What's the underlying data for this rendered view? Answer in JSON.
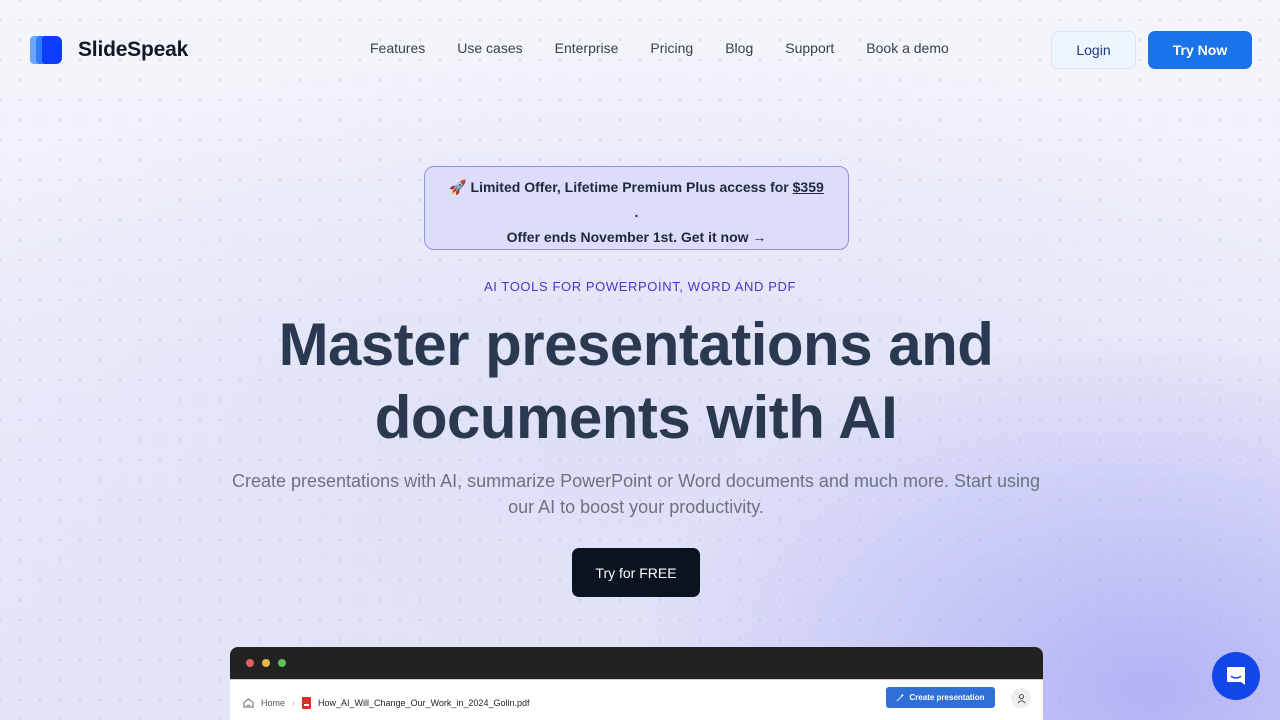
{
  "brand": {
    "name": "SlideSpeak",
    "logo_icon": "slides-stack-icon",
    "colors": {
      "primary": "#1a73e8",
      "logo_dark": "#0b3dff",
      "logo_mid": "#2f7bff",
      "logo_light": "#6aa8ff"
    }
  },
  "nav": {
    "items": [
      {
        "label": "Features"
      },
      {
        "label": "Use cases"
      },
      {
        "label": "Enterprise"
      },
      {
        "label": "Pricing"
      },
      {
        "label": "Blog"
      },
      {
        "label": "Support"
      },
      {
        "label": "Book a demo"
      }
    ],
    "login_label": "Login",
    "try_now_label": "Try Now"
  },
  "promo": {
    "icon": "🚀",
    "line1": "Limited Offer, Lifetime Premium Plus access for ",
    "price": "$359",
    "line2": ".",
    "line3": "Offer ends November 1st. Get it now →"
  },
  "hero": {
    "eyebrow": "AI TOOLS FOR POWERPOINT, WORD AND PDF",
    "headline_line1": "Master presentations and",
    "headline_line2": "documents with AI",
    "subtitle": "Create presentations with AI, summarize PowerPoint or Word documents and much more. Start using our AI to boost your productivity.",
    "cta_label": "Try for FREE"
  },
  "preview": {
    "window_dots": [
      "#e0605a",
      "#e6b84a",
      "#5fbf5a"
    ],
    "breadcrumb_home": "Home",
    "file_name": "How_AI_Will_Change_Our_Work_in_2024_Golin.pdf",
    "create_button_label": "Create presentation"
  },
  "chat": {
    "icon": "chat-bubble-icon"
  }
}
